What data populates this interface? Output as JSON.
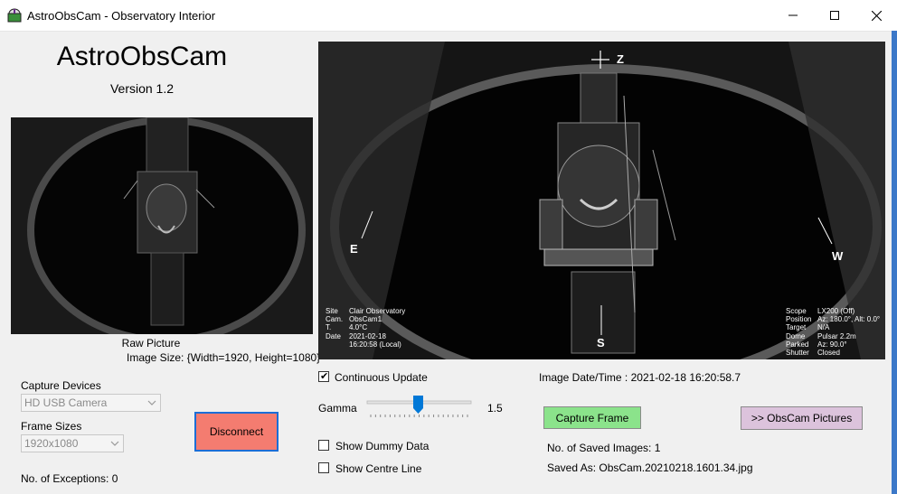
{
  "window": {
    "title": "AstroObsCam - Observatory Interior"
  },
  "app": {
    "heading": "AstroObsCam",
    "version": "Version  1.2"
  },
  "raw": {
    "caption": "Raw Picture",
    "size_label": "Image Size:",
    "size_value": "{Width=1920, Height=1080}"
  },
  "capture": {
    "label": "Capture Devices",
    "value": "HD USB Camera"
  },
  "frame_sizes": {
    "label": "Frame Sizes",
    "value": "1920x1080"
  },
  "exceptions": {
    "label": "No. of Exceptions:",
    "value": "0"
  },
  "disconnect_label": "Disconnect",
  "overlay": {
    "directions": {
      "zenith": "Z",
      "east": "E",
      "west": "W",
      "south": "S"
    },
    "left_keys": [
      "Site",
      "Cam.",
      "T.",
      "Date"
    ],
    "left_values": [
      "Clair Observatory",
      "ObsCam1",
      "4.0°C",
      "2021-02-18",
      "16:20:58 (Local)"
    ],
    "right_keys": [
      "Scope",
      "Position",
      "Target",
      "Dome",
      "Parked",
      "Shutter"
    ],
    "right_values": [
      "LX200 (Off)",
      "Az: 180.0°,  Alt: 0.0°",
      "N/A",
      "Pulsar 2.2m",
      "Az: 90.0°",
      "Closed"
    ]
  },
  "controls": {
    "continuous": {
      "label": "Continuous Update",
      "checked": true
    },
    "gamma": {
      "label": "Gamma",
      "value": "1.5",
      "level": 0.49
    },
    "dummy": {
      "label": "Show Dummy Data",
      "checked": false
    },
    "centre": {
      "label": "Show Centre Line",
      "checked": false
    }
  },
  "image_time": {
    "label": "Image Date/Time :",
    "value": "2021-02-18  16:20:58.7"
  },
  "capture_frame_label": "Capture Frame",
  "pictures_label": ">> ObsCam Pictures",
  "saved_count": {
    "label": "No. of Saved Images:",
    "value": "1"
  },
  "saved_as": {
    "label": "Saved As:",
    "value": "ObsCam.20210218.1601.34.jpg"
  },
  "colors": {
    "capture": "#8be38b",
    "pictures": "#dcc3dc",
    "disconnect": "#f47c70",
    "accent": "#0078d7"
  }
}
